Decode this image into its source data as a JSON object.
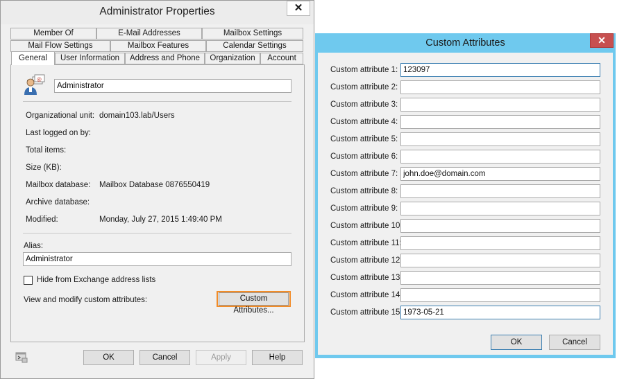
{
  "properties_window": {
    "title": "Administrator Properties",
    "close_symbol": "✕",
    "tabs_row1": [
      "Member Of",
      "E-Mail Addresses",
      "Mailbox Settings"
    ],
    "tabs_row2": [
      "Mail Flow Settings",
      "Mailbox Features",
      "Calendar Settings"
    ],
    "tabs_row3": [
      "General",
      "User Information",
      "Address and Phone",
      "Organization",
      "Account"
    ],
    "display_name": "Administrator",
    "fields": [
      {
        "label": "Organizational unit:",
        "value": "domain103.lab/Users"
      },
      {
        "label": "Last logged on by:",
        "value": ""
      },
      {
        "label": "Total items:",
        "value": ""
      },
      {
        "label": "Size (KB):",
        "value": ""
      },
      {
        "label": "Mailbox database:",
        "value": "Mailbox Database 0876550419"
      },
      {
        "label": "Archive database:",
        "value": ""
      },
      {
        "label": "Modified:",
        "value": "Monday, July 27, 2015 1:49:40 PM"
      }
    ],
    "alias_label": "Alias:",
    "alias_value": "Administrator",
    "hide_checkbox_label": "Hide from Exchange address lists",
    "custom_attr_text": "View and modify custom attributes:",
    "custom_attr_button": "Custom Attributes...",
    "buttons": {
      "ok": "OK",
      "cancel": "Cancel",
      "apply": "Apply",
      "help": "Help"
    }
  },
  "custom_window": {
    "title": "Custom Attributes",
    "close_symbol": "✕",
    "attributes": [
      {
        "label": "Custom attribute 1:",
        "value": "123097"
      },
      {
        "label": "Custom attribute 2:",
        "value": ""
      },
      {
        "label": "Custom attribute 3:",
        "value": ""
      },
      {
        "label": "Custom attribute 4:",
        "value": ""
      },
      {
        "label": "Custom attribute 5:",
        "value": ""
      },
      {
        "label": "Custom attribute 6:",
        "value": ""
      },
      {
        "label": "Custom attribute 7:",
        "value": "john.doe@domain.com"
      },
      {
        "label": "Custom attribute 8:",
        "value": ""
      },
      {
        "label": "Custom attribute 9:",
        "value": ""
      },
      {
        "label": "Custom attribute 10:",
        "value": ""
      },
      {
        "label": "Custom attribute 11:",
        "value": ""
      },
      {
        "label": "Custom attribute 12:",
        "value": ""
      },
      {
        "label": "Custom attribute 13:",
        "value": ""
      },
      {
        "label": "Custom attribute 14:",
        "value": ""
      },
      {
        "label": "Custom attribute 15:",
        "value": "1973-05-21"
      }
    ],
    "buttons": {
      "ok": "OK",
      "cancel": "Cancel"
    }
  },
  "colors": {
    "highlight_border": "#f28c28",
    "dialog_title_bg": "#6fc9ee",
    "close_button_red": "#c75050",
    "focused_input_border": "#3c7fb1"
  }
}
